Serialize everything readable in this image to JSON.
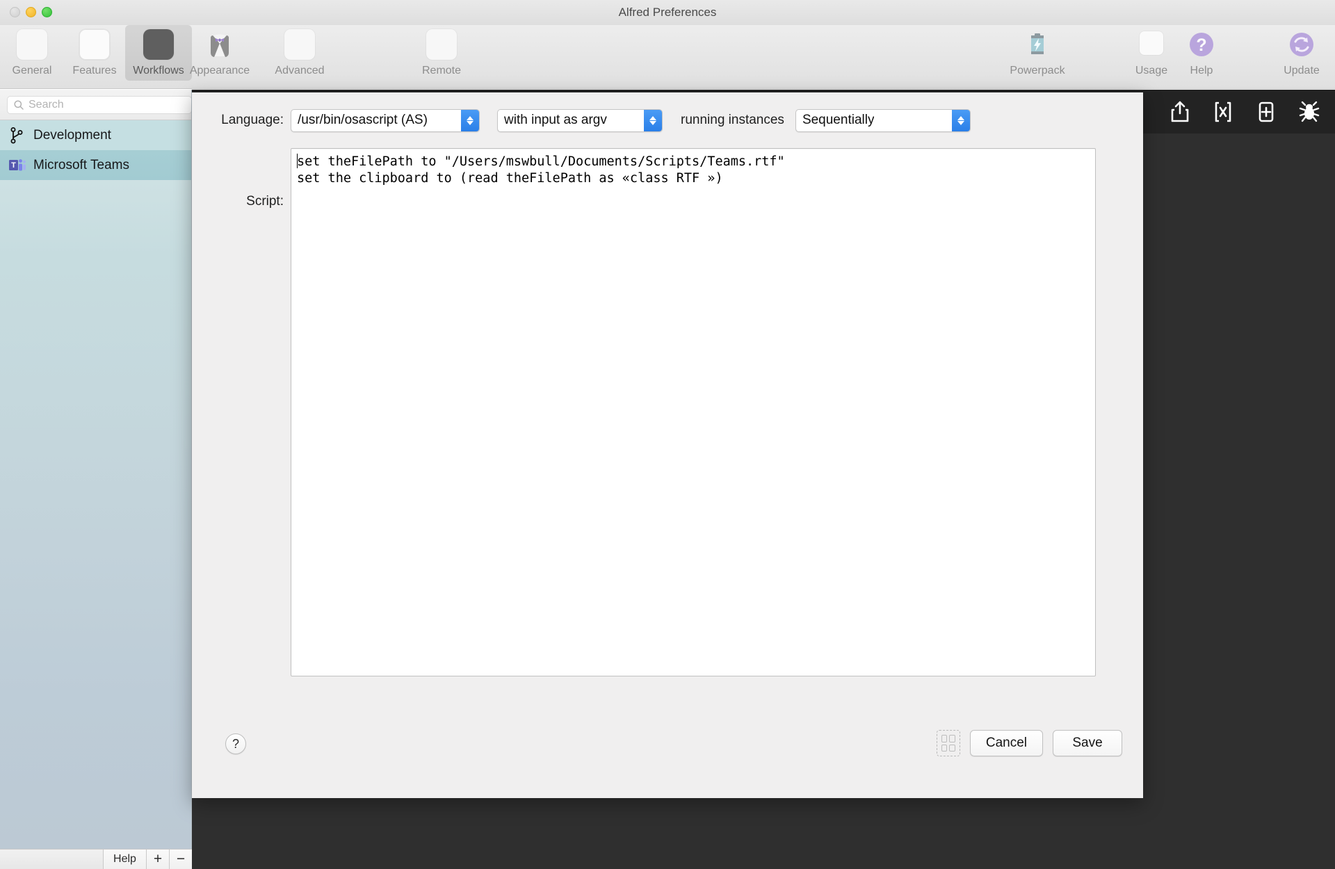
{
  "window": {
    "title": "Alfred Preferences",
    "traffic_lights": [
      "close",
      "minimize",
      "zoom"
    ]
  },
  "toolbar": {
    "items": [
      {
        "label": "General",
        "icon": "alfred-hat-icon",
        "selected": false
      },
      {
        "label": "Features",
        "icon": "checkmark-panel-icon",
        "selected": false
      },
      {
        "label": "Workflows",
        "icon": "workflow-grid-icon",
        "selected": true
      },
      {
        "label": "Appearance",
        "icon": "bowtie-tuxedo-icon",
        "selected": false
      },
      {
        "label": "Advanced",
        "icon": "toggles-icon",
        "selected": false
      },
      {
        "label": "Remote",
        "icon": "remote-signal-icon",
        "selected": false
      }
    ],
    "right_items": [
      {
        "label": "Powerpack",
        "icon": "battery-bolt-icon"
      },
      {
        "label": "Usage",
        "icon": "usage-chart-icon"
      },
      {
        "label": "Help",
        "icon": "question-mark-icon"
      },
      {
        "label": "Update",
        "icon": "refresh-sync-icon"
      }
    ]
  },
  "sidebar": {
    "search": {
      "placeholder": "Search",
      "value": "",
      "icon": "search-icon"
    },
    "workflows": [
      {
        "label": "Development",
        "icon": "git-branch-icon",
        "selected": false
      },
      {
        "label": "Microsoft Teams",
        "icon": "microsoft-teams-icon",
        "selected": true
      }
    ],
    "footer": {
      "help_label": "Help",
      "add_label": "+",
      "remove_label": "−"
    }
  },
  "canvas": {
    "toolbar_icons": [
      {
        "name": "share-export-icon"
      },
      {
        "name": "variables-icon"
      },
      {
        "name": "add-object-icon"
      },
      {
        "name": "debug-bug-icon"
      }
    ]
  },
  "sheet": {
    "language_label": "Language:",
    "language_value": "/usr/bin/osascript (AS)",
    "input_value": "with input as argv",
    "running_instances_label": "running instances",
    "instances_value": "Sequentially",
    "script_label": "Script:",
    "script_value": "set theFilePath to \"/Users/mswbull/Documents/Scripts/Teams.rtf\"\nset the clipboard to (read theFilePath as «class RTF »)",
    "help_button_label": "?",
    "cancel_label": "Cancel",
    "save_label": "Save"
  },
  "colors": {
    "accent_blue": "#2b7fe8",
    "sidebar_top": "#cfe2e4",
    "sidebar_bottom": "#bcc9d4",
    "selection": "#a2cbd2",
    "canvas_dark": "#2f2f2f",
    "canvas_toolbar": "#232323",
    "sheet_bg": "#f0efef",
    "accent_purple": "#a98fd0"
  }
}
